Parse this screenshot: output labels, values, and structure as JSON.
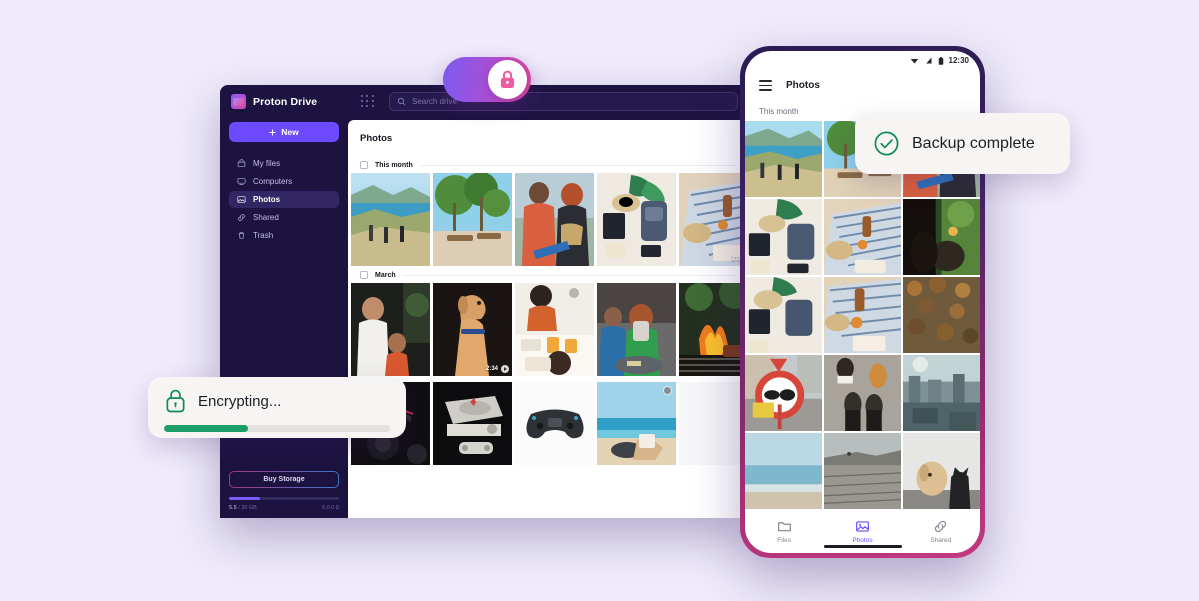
{
  "background_color": "#efebfb",
  "desktop": {
    "app_name": "Proton Drive",
    "new_button_label": "New",
    "search": {
      "placeholder": "Search drive"
    },
    "nav_items": [
      {
        "label": "My files",
        "icon": "folder-lock-icon",
        "active": false
      },
      {
        "label": "Computers",
        "icon": "monitor-icon",
        "active": false
      },
      {
        "label": "Photos",
        "icon": "photo-icon",
        "active": true
      },
      {
        "label": "Shared",
        "icon": "link-icon",
        "active": false
      },
      {
        "label": "Trash",
        "icon": "trash-icon",
        "active": false
      }
    ],
    "buy_storage_label": "Buy Storage",
    "storage_used": "5.5",
    "storage_total": "/ 30 GB",
    "storage_right": "5.0.0 β",
    "storage_percent": 28,
    "page_title": "Photos",
    "sections": [
      {
        "label": "This month",
        "photos": [
          {
            "alt": "friends-on-coastal-cliff",
            "badge": null
          },
          {
            "alt": "palm-beach-loungers",
            "badge": null
          },
          {
            "alt": "couple-with-skateboard",
            "badge": null
          },
          {
            "alt": "flatlay-travel-backpack",
            "badge": null
          },
          {
            "alt": "picnic-blanket-on-sand",
            "badge": "2:34"
          }
        ]
      },
      {
        "label": "March",
        "photos": [
          {
            "alt": "family-indoors-laughing",
            "badge": null
          },
          {
            "alt": "golden-dog-portrait",
            "badge": "2:34"
          },
          {
            "alt": "brunch-table-friends",
            "badge": null
          },
          {
            "alt": "woman-taking-phone-photo",
            "badge": null
          },
          {
            "alt": "bbq-grill-flames",
            "badge": null
          }
        ]
      },
      {
        "label": "",
        "photos": [
          {
            "alt": "dark-console-closeup",
            "badge": null
          },
          {
            "alt": "retro-playstation-console",
            "badge": null
          },
          {
            "alt": "game-controller-on-white",
            "badge": null
          },
          {
            "alt": "woman-reading-on-beach",
            "badge": "sync"
          },
          {
            "alt": "blank-tile",
            "badge": null
          }
        ]
      }
    ]
  },
  "toggle": {
    "name": "encryption-toggle",
    "state": "on",
    "gradient_from": "#7b5cf0",
    "gradient_to": "#e0449e",
    "icon": "lock-icon"
  },
  "phone": {
    "status_bar": {
      "time": "12:30",
      "icons": [
        "wifi-icon",
        "signal-icon",
        "battery-icon"
      ]
    },
    "app_title": "Photos",
    "menu_icon": "hamburger-menu-icon",
    "section_label": "This month",
    "photos": [
      "friends-on-coastal-cliff",
      "palm-beach-loungers",
      "couple-with-skateboard",
      "flatlay-travel-backpack",
      "picnic-blanket-on-sand",
      "aquarium-fish-tank",
      "flatlay-hat-and-camera",
      "drinks-on-striped-blanket",
      "autumn-leaves-ground",
      "road-sign-no-carts",
      "feet-on-pavement",
      "city-skyline-rooftop",
      "calm-sea-shoreline",
      "sandy-dunes-beach",
      "dog-and-cat-indoors"
    ],
    "nav": [
      {
        "label": "Files",
        "icon": "folder-icon",
        "active": false
      },
      {
        "label": "Photos",
        "icon": "photo-icon",
        "active": true
      },
      {
        "label": "Shared",
        "icon": "link-icon",
        "active": false
      }
    ]
  },
  "toasts": {
    "backup": {
      "text": "Backup complete",
      "icon": "check-circle-icon",
      "icon_color": "#0f8a5f"
    },
    "encrypting": {
      "text": "Encrypting...",
      "icon": "lock-icon",
      "icon_color": "#0f8a5f",
      "progress_percent": 37,
      "progress_color": "#1d9d67"
    }
  }
}
